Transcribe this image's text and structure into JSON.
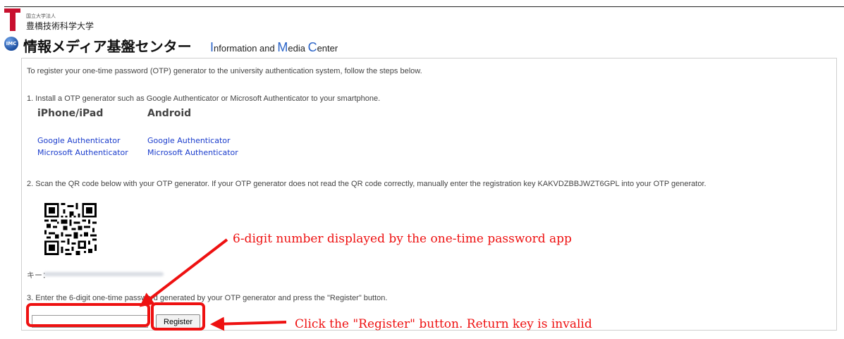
{
  "header": {
    "university_small": "国立大学法人",
    "university_name": "豊橋技術科学大学",
    "center_icon_text": "IMC",
    "center_name_jp": "情報メディア基盤センター",
    "center_name_en": {
      "i_cap": "I",
      "i_rest": "nformation and ",
      "m_cap": "M",
      "m_rest": "edia ",
      "c_cap": "C",
      "c_rest": "enter"
    }
  },
  "content": {
    "intro": "To register your one-time password (OTP) generator to the university authentication system, follow the steps below.",
    "step1": "1. Install a OTP generator such as Google Authenticator or Microsoft Authenticator to your smartphone.",
    "platforms": [
      {
        "heading": "iPhone/iPad",
        "links": [
          "Google Authenticator",
          "Microsoft Authenticator"
        ]
      },
      {
        "heading": "Android",
        "links": [
          "Google Authenticator",
          "Microsoft Authenticator"
        ]
      }
    ],
    "step2": "2. Scan the QR code below with your OTP generator. If your OTP generator does not read the QR code correctly, manually enter the registration key KAKVDZBBJWZT6GPL into your OTP generator.",
    "key_label": "キー：",
    "step3": "3. Enter the 6-digit one-time password generated by your OTP generator and press the \"Register\" button.",
    "otp_input_value": "",
    "register_label": "Register"
  },
  "annotations": {
    "input_hint": "6-digit number displayed by the one-time password app",
    "button_hint": "Click the \"Register\" button. Return key is invalid",
    "color": "#ee1111"
  },
  "colors": {
    "link": "#1a3ccc",
    "brand_red": "#c8102e",
    "brand_blue": "#2b64c8"
  }
}
